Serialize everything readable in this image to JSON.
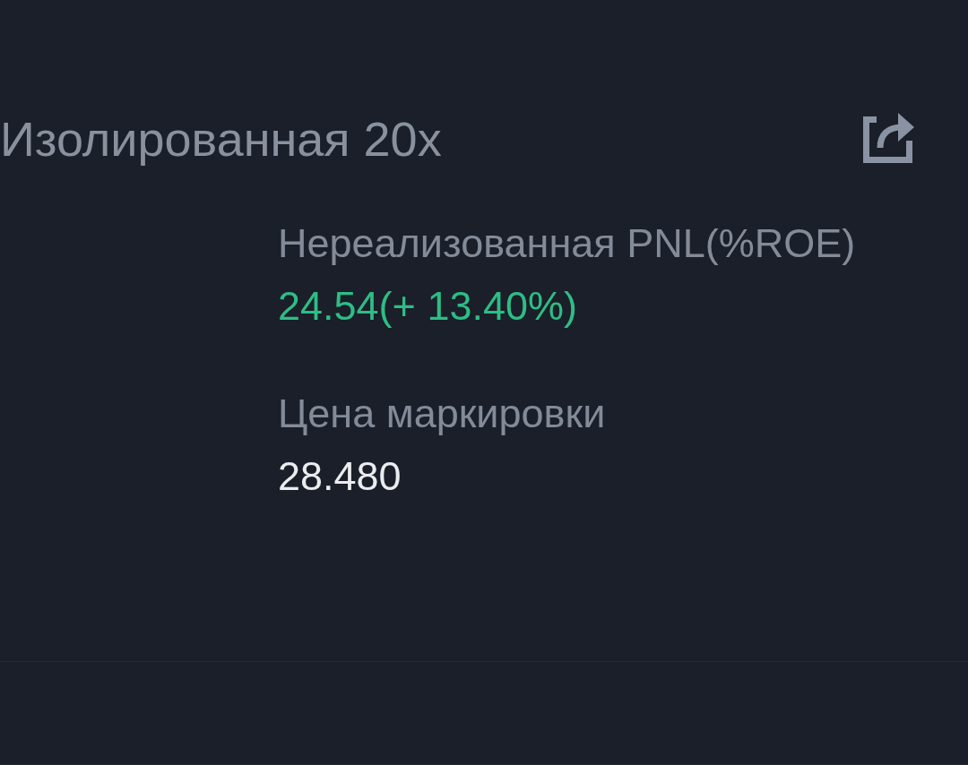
{
  "position": {
    "margin_mode": "Изолированная 20x",
    "share_button": {
      "kind": "share"
    }
  },
  "fields": [
    {
      "label": "Нереализованная PNL(%ROE)",
      "value": "24.54(+ 13.40%)",
      "kind": "profit"
    },
    {
      "label": "Цена маркировки",
      "value": "28.480",
      "kind": "plain"
    }
  ]
}
